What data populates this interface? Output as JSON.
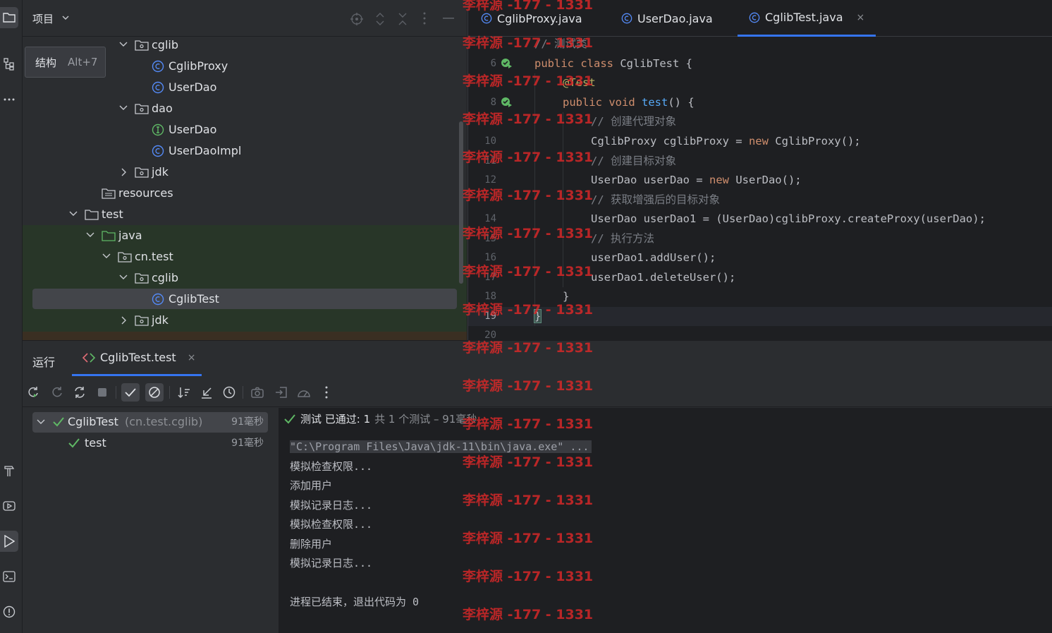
{
  "project": {
    "title": "项目",
    "tree": [
      {
        "label": "cglib",
        "type": "package",
        "expanded": true
      },
      {
        "label": "CglibProxy",
        "type": "class"
      },
      {
        "label": "UserDao",
        "type": "class"
      },
      {
        "label": "dao",
        "type": "package",
        "expanded": true
      },
      {
        "label": "UserDao",
        "type": "interface"
      },
      {
        "label": "UserDaoImpl",
        "type": "class"
      },
      {
        "label": "jdk",
        "type": "package",
        "expanded": false
      },
      {
        "label": "resources",
        "type": "resources"
      },
      {
        "label": "test",
        "type": "folder",
        "expanded": true
      },
      {
        "label": "java",
        "type": "source-folder",
        "expanded": true
      },
      {
        "label": "cn.test",
        "type": "package",
        "expanded": true
      },
      {
        "label": "cglib",
        "type": "package",
        "expanded": true
      },
      {
        "label": "CglibTest",
        "type": "class",
        "selected": true
      },
      {
        "label": "jdk",
        "type": "package",
        "expanded": false
      }
    ]
  },
  "tooltip": {
    "label": "结构",
    "shortcut": "Alt+7"
  },
  "editor": {
    "tabs": [
      {
        "label": "CglibProxy.java",
        "active": false
      },
      {
        "label": "UserDao.java",
        "active": false
      },
      {
        "label": "CglibTest.java",
        "active": true
      }
    ],
    "close_glyph": "×",
    "line_numbers": [
      "6",
      "8",
      "10",
      "11",
      "12",
      "14",
      "15",
      "16",
      "17",
      "18",
      "19",
      "20"
    ],
    "lines": {
      "l5": "// 测试类",
      "l6a": "public",
      "l6b": " ",
      "l6c": "class",
      "l6d": " CglibTest {",
      "l7": "@Test",
      "l8a": "public",
      "l8b": " ",
      "l8c": "void",
      "l8d": " ",
      "l8e": "test",
      "l8f": "() {",
      "l9": "// 创建代理对象",
      "l10a": "CglibProxy cglibProxy = ",
      "l10b": "new",
      "l10c": " CglibProxy();",
      "l11": "// 创建目标对象",
      "l12a": "UserDao userDao = ",
      "l12b": "new",
      "l12c": " UserDao();",
      "l13": "// 获取增强后的目标对象",
      "l14": "UserDao userDao1 = (UserDao)cglibProxy.createProxy(userDao);",
      "l15": "// 执行方法",
      "l16": "userDao1.addUser();",
      "l17": "userDao1.deleteUser();",
      "l18": "}",
      "l19": "}"
    }
  },
  "run": {
    "title": "运行",
    "tab_label": "CglibTest.test",
    "tests": [
      {
        "name": "CglibTest",
        "package": "(cn.test.cglib)",
        "duration": "91毫秒"
      },
      {
        "name": "test",
        "duration": "91毫秒"
      }
    ],
    "status": {
      "prefix": "测试 已通过:",
      "count": "1",
      "detail": "共 1 个测试 – 91毫秒"
    },
    "console": [
      "\"C:\\Program Files\\Java\\jdk-11\\bin\\java.exe\" ...",
      "模拟检查权限...",
      "添加用户",
      "模拟记录日志...",
      "模拟检查权限...",
      "删除用户",
      "模拟记录日志...",
      "",
      "进程已结束，退出代码为 0"
    ]
  },
  "watermark": "李梓源 -177 - 1331",
  "colors": {
    "accent": "#3574f0",
    "success": "#5fb865",
    "class_icon": "#548af7",
    "interface_icon": "#5fb865"
  }
}
